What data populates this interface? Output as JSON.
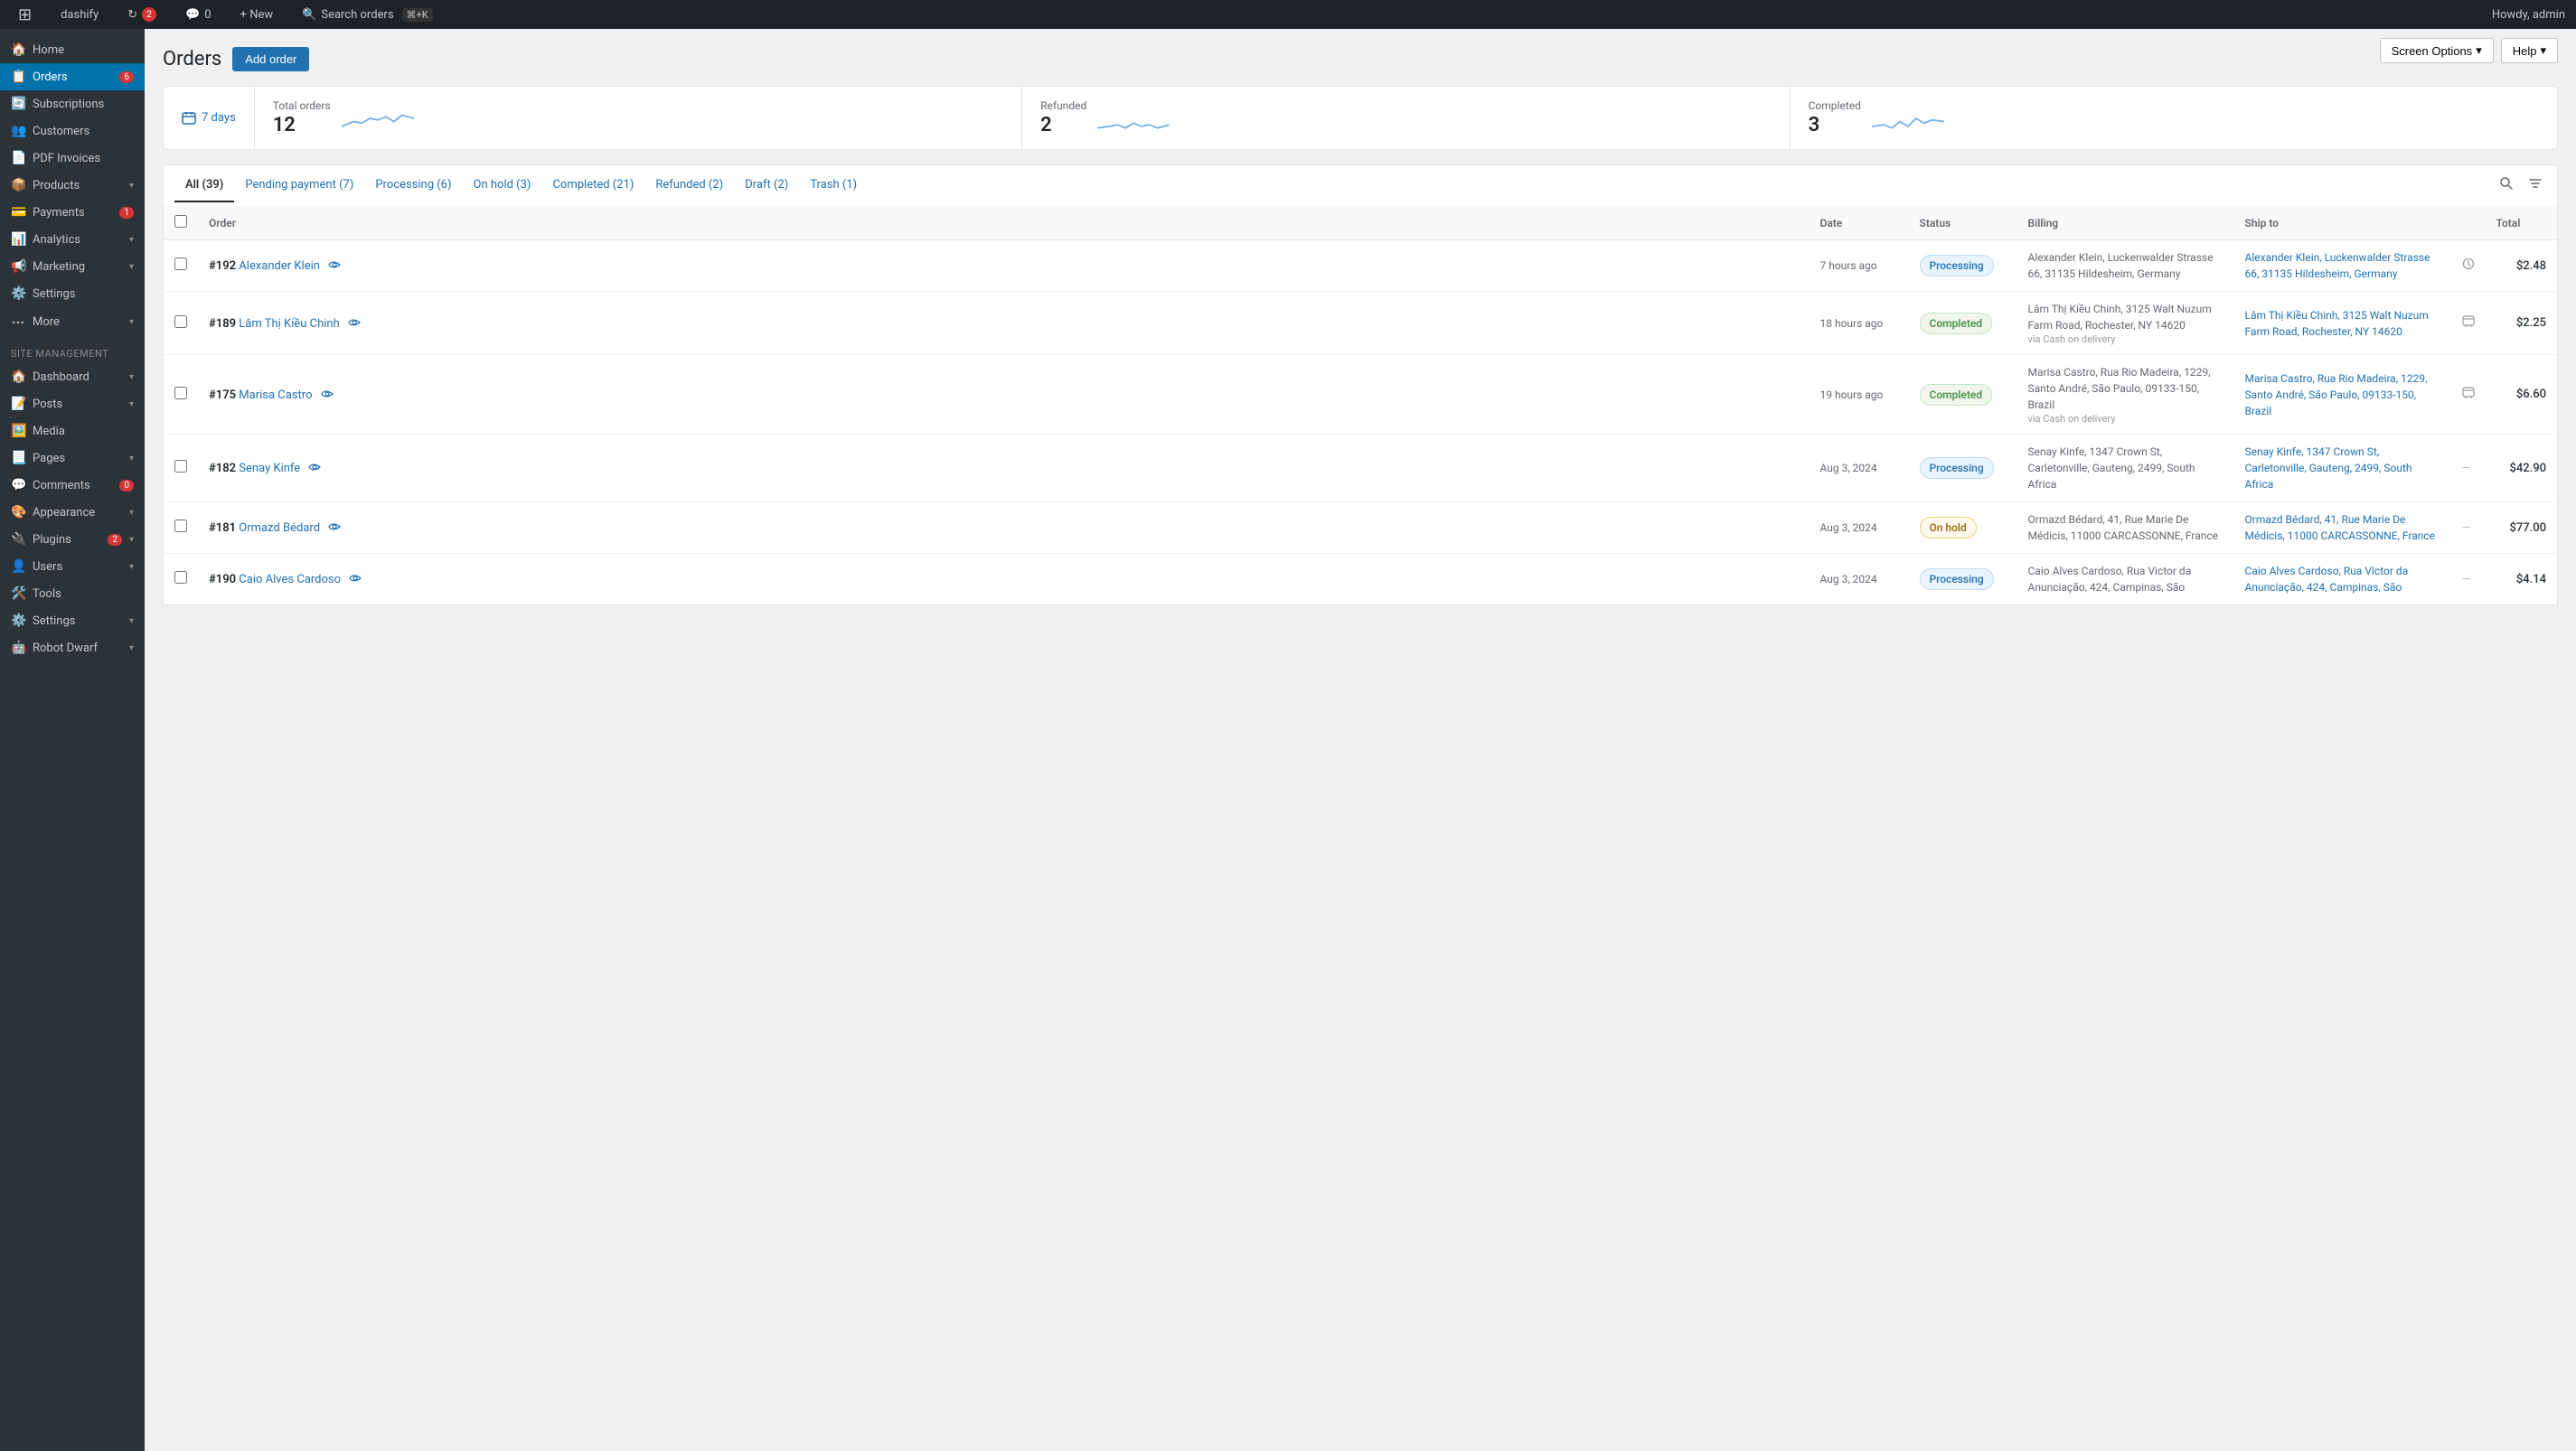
{
  "adminbar": {
    "site_name": "dashify",
    "update_count": "2",
    "comments_count": "0",
    "new_label": "+ New",
    "search_orders_label": "Search orders",
    "search_shortcut": "⌘+K",
    "howdy": "Howdy, admin"
  },
  "screen_options": {
    "label": "Screen Options",
    "help_label": "Help"
  },
  "sidebar": {
    "woocommerce_items": [
      {
        "id": "home",
        "label": "Home",
        "icon": "🏠",
        "badge": null,
        "arrow": false
      },
      {
        "id": "orders",
        "label": "Orders",
        "icon": "📋",
        "badge": "6",
        "arrow": false,
        "active": true
      },
      {
        "id": "subscriptions",
        "label": "Subscriptions",
        "icon": "🔄",
        "badge": null,
        "arrow": false
      },
      {
        "id": "customers",
        "label": "Customers",
        "icon": "👥",
        "badge": null,
        "arrow": false
      },
      {
        "id": "pdf-invoices",
        "label": "PDF Invoices",
        "icon": "📄",
        "badge": null,
        "arrow": false
      },
      {
        "id": "products",
        "label": "Products",
        "icon": "📦",
        "badge": null,
        "arrow": true
      },
      {
        "id": "payments",
        "label": "Payments",
        "icon": "💳",
        "badge": "1",
        "arrow": false
      },
      {
        "id": "analytics",
        "label": "Analytics",
        "icon": "📊",
        "badge": null,
        "arrow": true
      },
      {
        "id": "marketing",
        "label": "Marketing",
        "icon": "📢",
        "badge": null,
        "arrow": true
      },
      {
        "id": "settings",
        "label": "Settings",
        "icon": "⚙️",
        "badge": null,
        "arrow": false
      },
      {
        "id": "more",
        "label": "More",
        "icon": "···",
        "badge": null,
        "arrow": true
      }
    ],
    "site_management_label": "Site management",
    "site_items": [
      {
        "id": "dashboard",
        "label": "Dashboard",
        "icon": "🏠",
        "badge": null,
        "arrow": true
      },
      {
        "id": "posts",
        "label": "Posts",
        "icon": "📝",
        "badge": null,
        "arrow": true
      },
      {
        "id": "media",
        "label": "Media",
        "icon": "🖼️",
        "badge": null,
        "arrow": false
      },
      {
        "id": "pages",
        "label": "Pages",
        "icon": "📃",
        "badge": null,
        "arrow": true
      },
      {
        "id": "comments",
        "label": "Comments",
        "icon": "💬",
        "badge": "0",
        "arrow": false
      },
      {
        "id": "appearance",
        "label": "Appearance",
        "icon": "🎨",
        "badge": null,
        "arrow": true
      },
      {
        "id": "plugins",
        "label": "Plugins",
        "icon": "🔌",
        "badge": "2",
        "arrow": true
      },
      {
        "id": "users",
        "label": "Users",
        "icon": "👤",
        "badge": null,
        "arrow": true
      },
      {
        "id": "tools",
        "label": "Tools",
        "icon": "🛠️",
        "badge": null,
        "arrow": false
      },
      {
        "id": "settings2",
        "label": "Settings",
        "icon": "⚙️",
        "badge": null,
        "arrow": true
      },
      {
        "id": "robot-dwarf",
        "label": "Robot Dwarf",
        "icon": "🤖",
        "badge": null,
        "arrow": true
      }
    ]
  },
  "page": {
    "title": "Orders",
    "add_order_label": "Add order"
  },
  "stats": {
    "period": "7 days",
    "total_orders_label": "Total orders",
    "total_orders_value": "12",
    "refunded_label": "Refunded",
    "refunded_value": "2",
    "completed_label": "Completed",
    "completed_value": "3"
  },
  "filter_tabs": [
    {
      "id": "all",
      "label": "All (39)",
      "active": true
    },
    {
      "id": "pending",
      "label": "Pending payment (7)",
      "active": false
    },
    {
      "id": "processing",
      "label": "Processing (6)",
      "active": false
    },
    {
      "id": "on-hold",
      "label": "On hold (3)",
      "active": false
    },
    {
      "id": "completed",
      "label": "Completed (21)",
      "active": false
    },
    {
      "id": "refunded",
      "label": "Refunded (2)",
      "active": false
    },
    {
      "id": "draft",
      "label": "Draft (2)",
      "active": false
    },
    {
      "id": "trash",
      "label": "Trash (1)",
      "active": false
    }
  ],
  "table": {
    "columns": [
      "Order",
      "Date",
      "Status",
      "Billing",
      "Ship to",
      "",
      "Total"
    ],
    "rows": [
      {
        "id": "#192",
        "name": "Alexander Klein",
        "date": "7 hours ago",
        "status": "Processing",
        "status_type": "processing",
        "billing": "Alexander Klein, Luckenwalder Strasse 66, 31135 Hildesheim, Germany",
        "via": "",
        "ship_to": "Alexander Klein, Luckenwalder Strasse 66, 31135 Hildesheim, Germany",
        "has_clock": true,
        "total": "$2.48"
      },
      {
        "id": "#189",
        "name": "Lâm Thị Kiều Chinh",
        "date": "18 hours ago",
        "status": "Completed",
        "status_type": "completed",
        "billing": "Lâm Thị Kiều Chinh, 3125 Walt Nuzum Farm Road, Rochester, NY 14620",
        "via": "via Cash on delivery",
        "ship_to": "Lâm Thị Kiều Chinh, 3125 Walt Nuzum Farm Road, Rochester, NY 14620",
        "has_clock": false,
        "total": "$2.25"
      },
      {
        "id": "#175",
        "name": "Marisa Castro",
        "date": "19 hours ago",
        "status": "Completed",
        "status_type": "completed",
        "billing": "Marisa Castro, Rua Rio Madeira, 1229, Santo André, São Paulo, 09133-150, Brazil",
        "via": "via Cash on delivery",
        "ship_to": "Marisa Castro, Rua Rio Madeira, 1229, Santo André, São Paulo, 09133-150, Brazil",
        "has_clock": false,
        "total": "$6.60"
      },
      {
        "id": "#182",
        "name": "Senay Kinfe",
        "date": "Aug 3, 2024",
        "status": "Processing",
        "status_type": "processing",
        "billing": "Senay Kinfe, 1347 Crown St, Carletonville, Gauteng, 2499, South Africa",
        "via": "",
        "ship_to": "Senay Kinfe, 1347 Crown St, Carletonville, Gauteng, 2499, South Africa",
        "has_clock": false,
        "total": "$42.90"
      },
      {
        "id": "#181",
        "name": "Ormazd Bédard",
        "date": "Aug 3, 2024",
        "status": "On hold",
        "status_type": "on-hold",
        "billing": "Ormazd Bédard, 41, Rue Marie De Médicis, 11000 CARCASSONNE, France",
        "via": "",
        "ship_to": "Ormazd Bédard, 41, Rue Marie De Médicis, 11000 CARCASSONNE, France",
        "has_clock": false,
        "total": "$77.00"
      },
      {
        "id": "#190",
        "name": "Caio Alves Cardoso",
        "date": "Aug 3, 2024",
        "status": "Processing",
        "status_type": "processing",
        "billing": "Caio Alves Cardoso, Rua Victor da Anunciação, 424, Campinas, São",
        "via": "",
        "ship_to": "Caio Alves Cardoso, Rua Victor da Anunciação, 424, Campinas, São",
        "has_clock": false,
        "total": "$4.14"
      }
    ]
  }
}
